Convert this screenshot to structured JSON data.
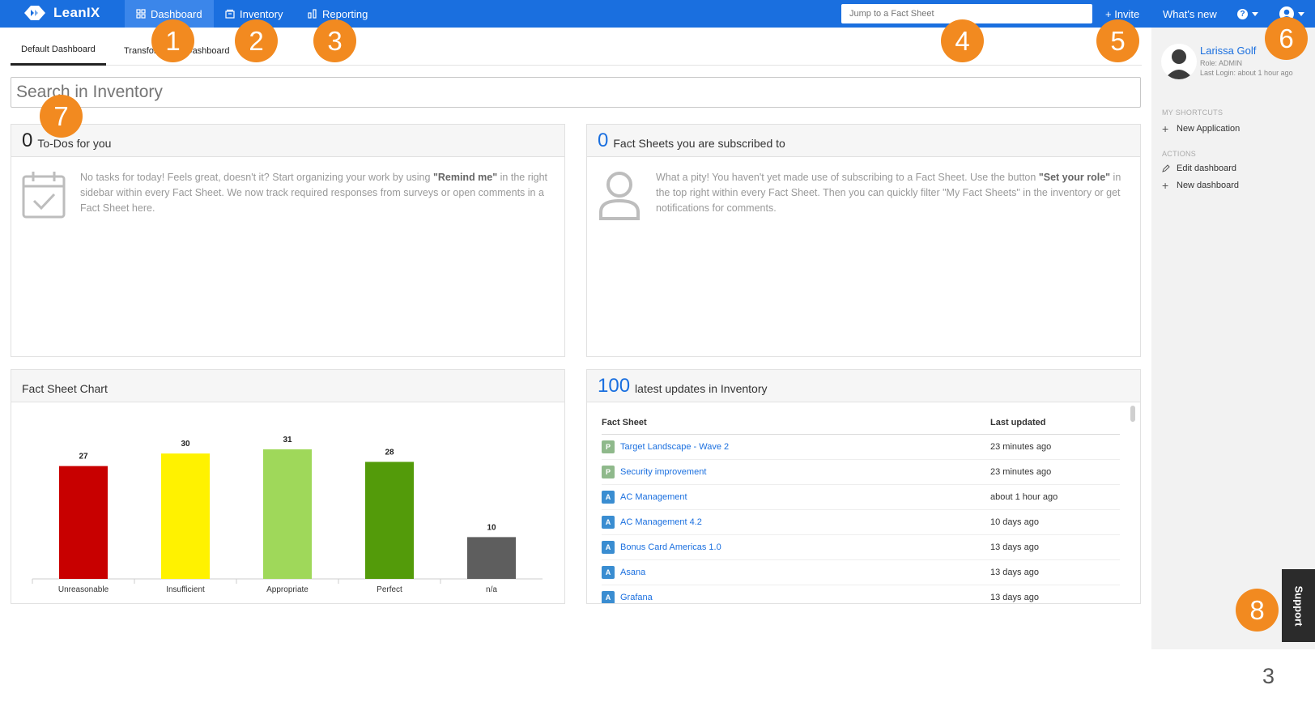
{
  "app": {
    "name": "LeanIX"
  },
  "nav": [
    {
      "label": "Dashboard",
      "active": true
    },
    {
      "label": "Inventory",
      "active": false
    },
    {
      "label": "Reporting",
      "active": false
    }
  ],
  "jump_placeholder": "Jump to a Fact Sheet",
  "top_links": {
    "invite": "+ Invite",
    "whats_new": "What's new",
    "help": "?"
  },
  "tabs": [
    {
      "label": "Default Dashboard",
      "active": true
    },
    {
      "label": "Transformation Dashboard",
      "active": false
    }
  ],
  "search_placeholder": "Search in Inventory",
  "todos": {
    "count": "0",
    "title": "To-Dos for you",
    "text_pre": "No tasks for today! Feels great, doesn't it? Start organizing your work by using ",
    "text_bold": "\"Remind me\"",
    "text_post": " in the right sidebar within every Fact Sheet. We now track required responses from surveys or open comments in a Fact Sheet here."
  },
  "subscribed": {
    "count": "0",
    "title": "Fact Sheets you are subscribed to",
    "text_pre": "What a pity! You haven't yet made use of subscribing to a Fact Sheet. Use the button ",
    "text_bold": "\"Set your role\"",
    "text_post": " in the top right within every Fact Sheet. Then you can quickly filter \"My Fact Sheets\" in the inventory or get notifications for comments."
  },
  "chart_panel": {
    "title": "Fact Sheet Chart"
  },
  "chart_data": {
    "type": "bar",
    "categories": [
      "Unreasonable",
      "Insufficient",
      "Appropriate",
      "Perfect",
      "n/a"
    ],
    "values": [
      27,
      30,
      31,
      28,
      10
    ],
    "colors": [
      "#c80000",
      "#fff200",
      "#9fd85a",
      "#539b0a",
      "#5e5e5e"
    ],
    "ylim": [
      0,
      31
    ],
    "title": "",
    "xlabel": "",
    "ylabel": ""
  },
  "updates": {
    "count": "100",
    "title": "latest updates in Inventory",
    "col_fact_sheet": "Fact Sheet",
    "col_last_updated": "Last updated",
    "rows": [
      {
        "type": "P",
        "name": "Target Landscape - Wave 2",
        "updated": "23 minutes ago"
      },
      {
        "type": "P",
        "name": "Security improvement",
        "updated": "23 minutes ago"
      },
      {
        "type": "A",
        "name": "AC Management",
        "updated": "about 1 hour ago"
      },
      {
        "type": "A",
        "name": "AC Management 4.2",
        "updated": "10 days ago"
      },
      {
        "type": "A",
        "name": "Bonus Card Americas 1.0",
        "updated": "13 days ago"
      },
      {
        "type": "A",
        "name": "Asana",
        "updated": "13 days ago"
      },
      {
        "type": "A",
        "name": "Grafana",
        "updated": "13 days ago"
      }
    ],
    "badge_colors": {
      "P": "#8fb98b",
      "A": "#3a8dd1"
    }
  },
  "sidebar": {
    "user_name": "Larissa Golf",
    "role": "Role: ADMIN",
    "last_login": "Last Login: about 1 hour ago",
    "shortcuts_label": "MY SHORTCUTS",
    "shortcut_new_app": "New Application",
    "actions_label": "ACTIONS",
    "edit_dashboard": "Edit dashboard",
    "new_dashboard": "New dashboard"
  },
  "support": "Support",
  "callouts": [
    "1",
    "2",
    "3",
    "4",
    "5",
    "6",
    "7",
    "8"
  ],
  "page_number": "3"
}
